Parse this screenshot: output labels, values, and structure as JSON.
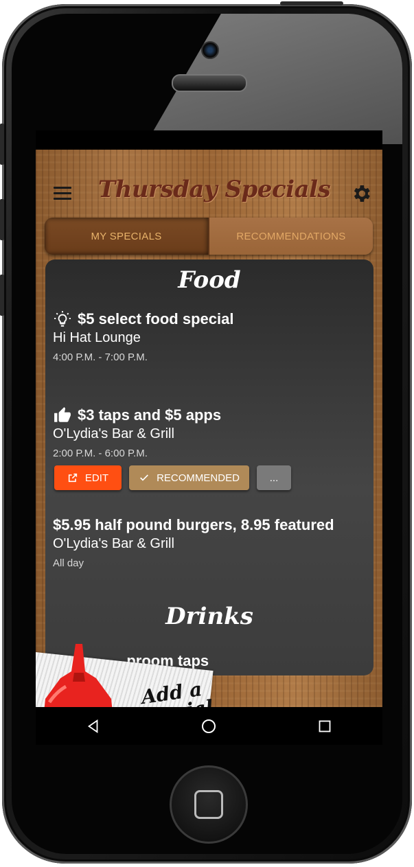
{
  "app": {
    "title": "Thursday Specials"
  },
  "tabs": [
    {
      "label": "MY SPECIALS",
      "active": true
    },
    {
      "label": "RECOMMENDATIONS",
      "active": false
    }
  ],
  "sections": {
    "food_title": "Food",
    "drinks_title": "Drinks"
  },
  "specials": [
    {
      "icon": "lightbulb-icon",
      "title": "$5 select food special",
      "venue": "Hi Hat Lounge",
      "time": "4:00 P.M. - 7:00 P.M."
    },
    {
      "icon": "thumbs-up-icon",
      "title": "$3 taps and $5 apps",
      "venue": "O'Lydia's Bar & Grill",
      "time": "2:00 P.M. - 6:00 P.M."
    },
    {
      "icon": "",
      "title": "$5.95 half pound burgers, 8.95 featured",
      "venue": "O'Lydia's Bar & Grill",
      "time": "All day"
    }
  ],
  "actions": {
    "edit": "EDIT",
    "recommended": "RECOMMENDED",
    "more": "..."
  },
  "drinks_peek": "...proom taps",
  "add_special": {
    "line1": "Add a",
    "line2": "Special"
  },
  "colors": {
    "edit": "#ff4f12",
    "recommended": "#b08a58",
    "more": "#7a7a7a",
    "tab_text": "#e8b36a",
    "title": "#6a2a1a"
  }
}
